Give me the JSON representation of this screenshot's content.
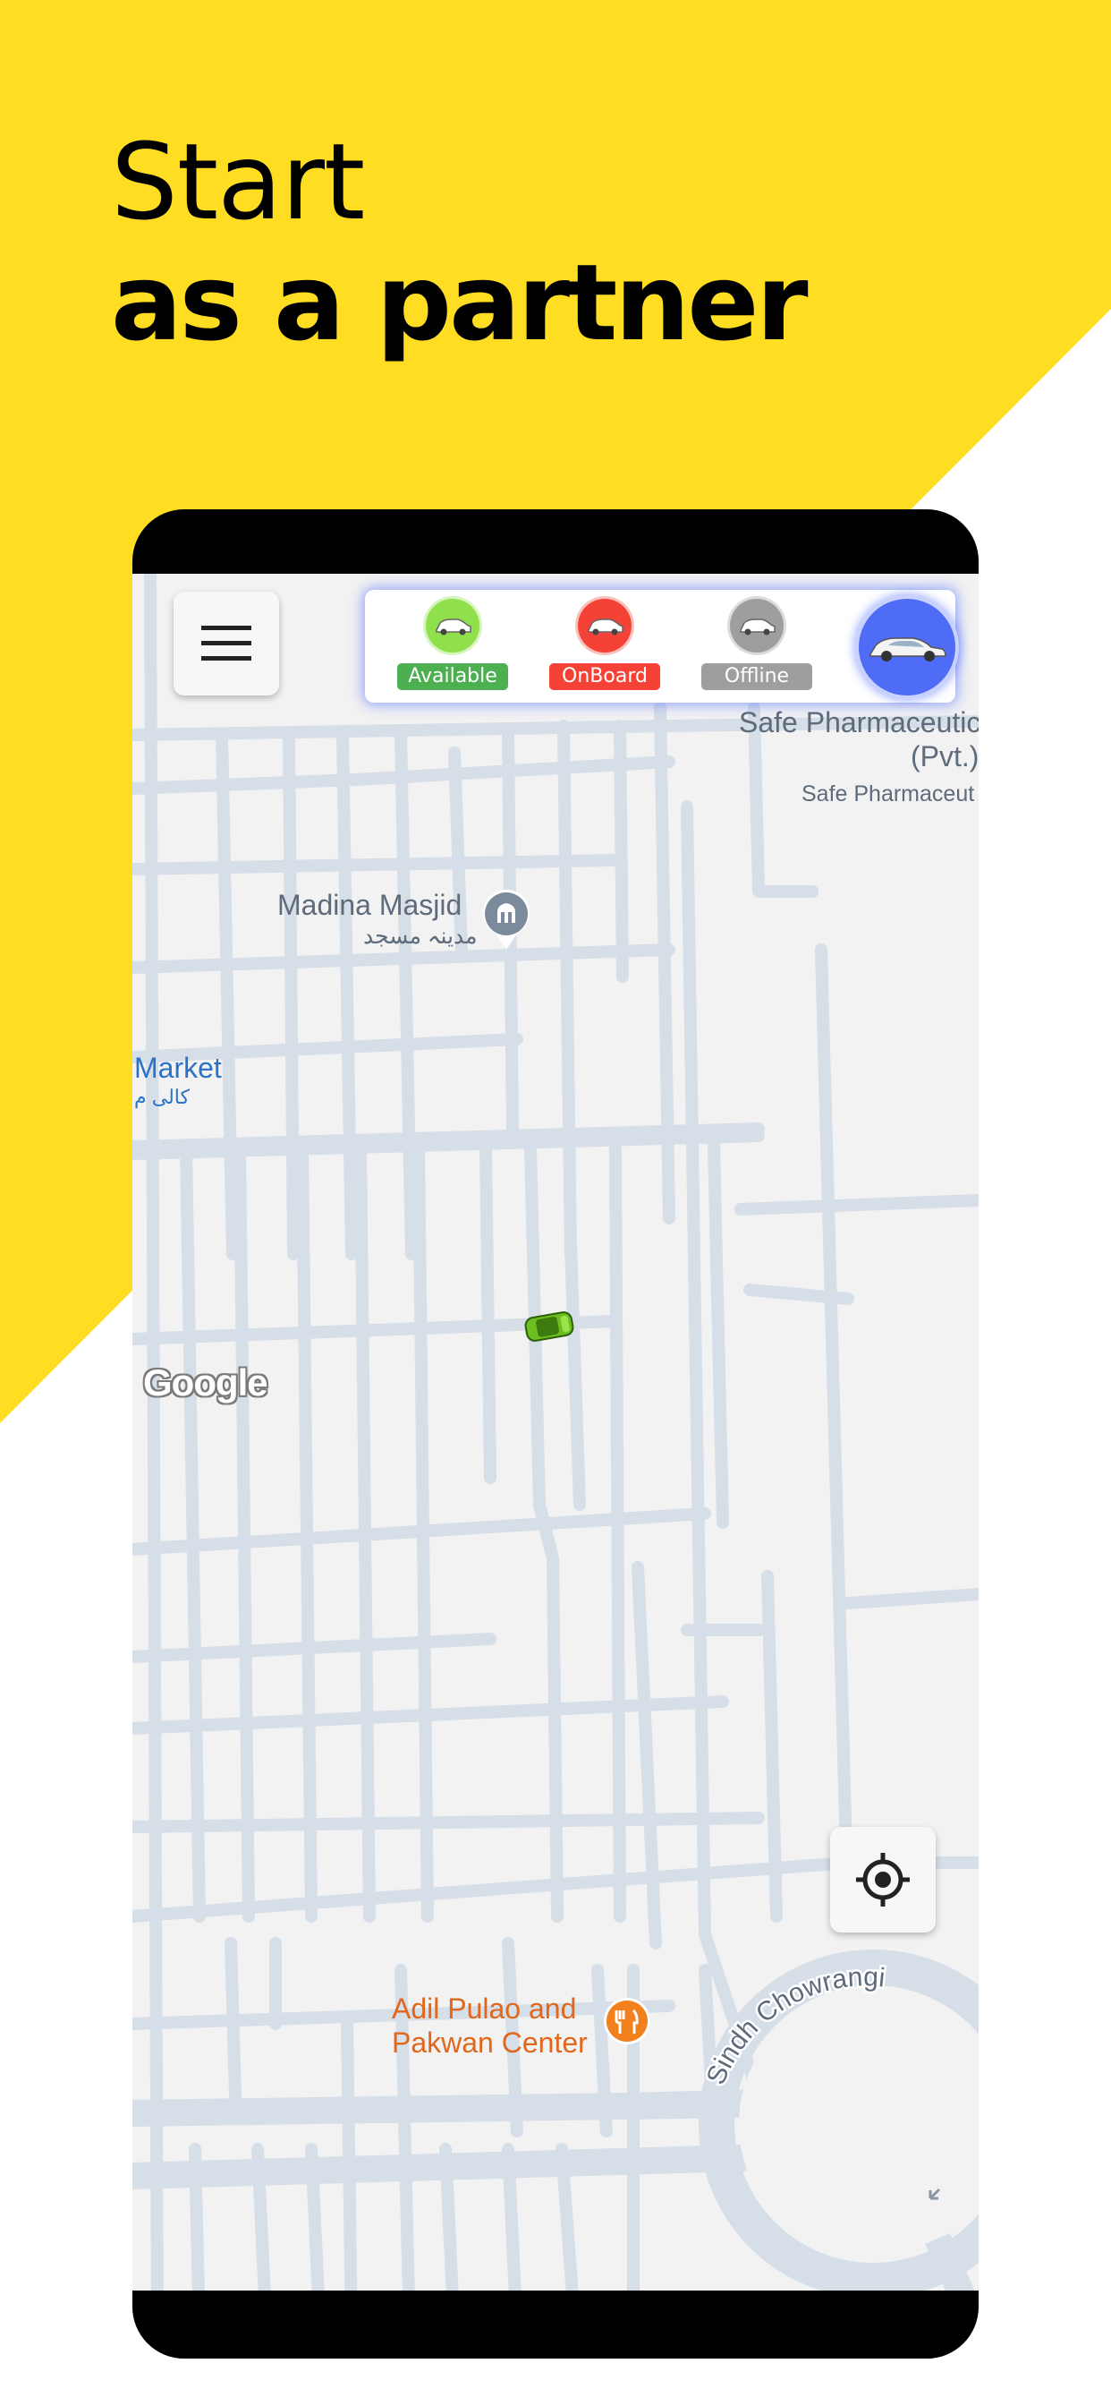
{
  "headline": {
    "line1": "Start",
    "line2": "as a partner"
  },
  "colors": {
    "background_yellow": "#FEDD22",
    "map_background": "#f2f2f2",
    "road": "#d6dee7",
    "available_green": "#4caf50",
    "onboard_red": "#f44336",
    "offline_gray": "#9e9e9e",
    "main_button_blue": "#4f6cf7"
  },
  "status_panel": {
    "available_label": "Available",
    "onboard_label": "OnBoard",
    "offline_label": "Offline"
  },
  "map": {
    "pois": {
      "safe_pharma_line1": "Safe Pharmaceutic",
      "safe_pharma_line2": "(Pvt.)",
      "safe_pharma_sub": "Safe Pharmaceut",
      "madina_masjid": "Madina Masjid",
      "madina_masjid_urdu": "مدینہ مسجد",
      "market": "Market",
      "market_urdu": "کالی م",
      "adil_line1": "Adil Pulao and",
      "adil_line2": "Pakwan Center",
      "sindh_chowrangi": "Sindh Chowrangi"
    },
    "google_label": "Google"
  },
  "icons": {
    "menu": "hamburger-menu-icon",
    "locate": "my-location-icon",
    "car": "car-icon",
    "mosque": "mosque-icon",
    "restaurant": "fork-knife-icon"
  }
}
